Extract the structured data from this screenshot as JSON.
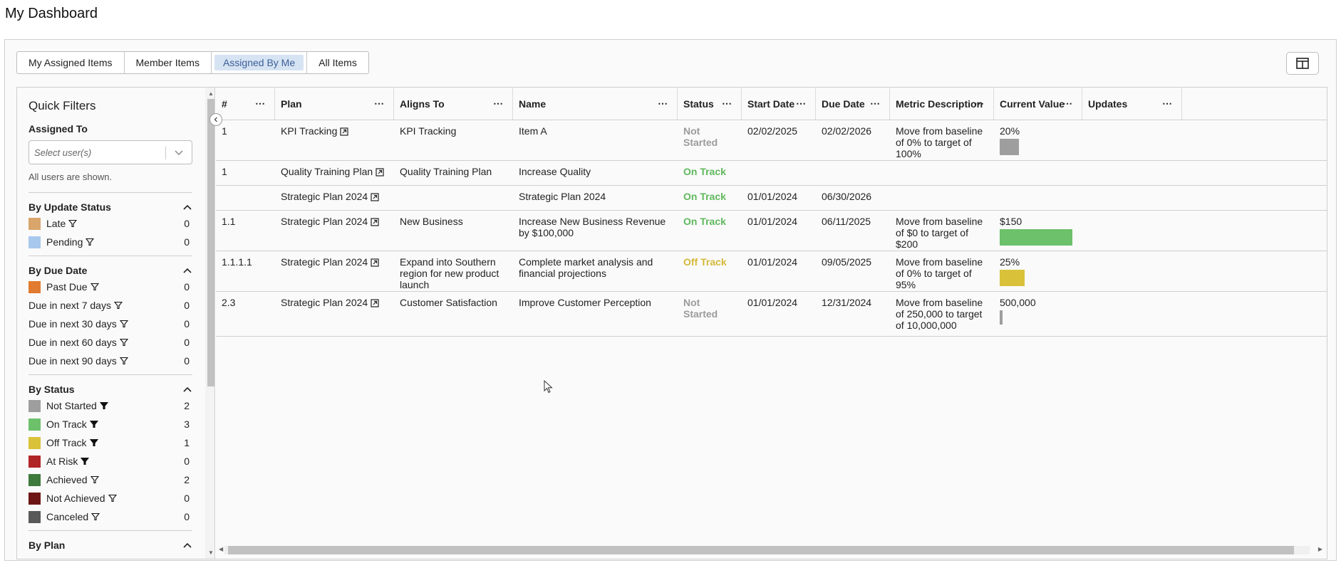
{
  "page_title": "My Dashboard",
  "tabs": [
    {
      "label": "My Assigned Items"
    },
    {
      "label": "Member Items"
    },
    {
      "label": "Assigned By Me"
    },
    {
      "label": "All Items"
    }
  ],
  "sidebar": {
    "title": "Quick Filters",
    "assigned_to_label": "Assigned To",
    "select_placeholder": "Select user(s)",
    "users_note": "All users are shown.",
    "update_status": {
      "heading": "By Update Status",
      "items": [
        {
          "label": "Late",
          "count": "0",
          "color": "#d9a56b"
        },
        {
          "label": "Pending",
          "count": "0",
          "color": "#a8c8ee"
        }
      ]
    },
    "due_date": {
      "heading": "By Due Date",
      "items": [
        {
          "label": "Past Due",
          "count": "0",
          "color": "#e07b30"
        },
        {
          "label": "Due in next 7 days",
          "count": "0"
        },
        {
          "label": "Due in next 30 days",
          "count": "0"
        },
        {
          "label": "Due in next 60 days",
          "count": "0"
        },
        {
          "label": "Due in next 90 days",
          "count": "0"
        }
      ]
    },
    "status": {
      "heading": "By Status",
      "items": [
        {
          "label": "Not Started",
          "count": "2",
          "color": "#9e9e9e",
          "filled": true
        },
        {
          "label": "On Track",
          "count": "3",
          "color": "#6cc16a",
          "filled": true
        },
        {
          "label": "Off Track",
          "count": "1",
          "color": "#d9c23a",
          "filled": true
        },
        {
          "label": "At Risk",
          "count": "0",
          "color": "#b02525",
          "filled": true
        },
        {
          "label": "Achieved",
          "count": "2",
          "color": "#3e7a3c",
          "filled": false
        },
        {
          "label": "Not Achieved",
          "count": "0",
          "color": "#6e1515",
          "filled": false
        },
        {
          "label": "Canceled",
          "count": "0",
          "color": "#595959",
          "filled": false
        }
      ]
    },
    "next_heading": "By Plan"
  },
  "grid": {
    "columns": [
      "#",
      "Plan",
      "Aligns To",
      "Name",
      "Status",
      "Start Date",
      "Due Date",
      "Metric Description",
      "Current Value",
      "Updates"
    ],
    "rows": [
      {
        "num": "1",
        "plan": "KPI Tracking",
        "aligns": "KPI Tracking",
        "name": "Item A",
        "status": "Not Started",
        "status_color": "#9b9b9b",
        "start": "02/02/2025",
        "due": "02/02/2026",
        "metric": "Move from baseline of 0% to target of 100%",
        "value": "20%",
        "progress": 0.2,
        "bar_color": "#9e9e9e"
      },
      {
        "num": "1",
        "plan": "Quality Training Plan",
        "aligns": "Quality Training Plan",
        "name": "Increase Quality",
        "status": "On Track",
        "status_color": "#5fb85c",
        "start": "",
        "due": "",
        "metric": "",
        "value": "",
        "progress": null,
        "bar_color": ""
      },
      {
        "num": "",
        "plan": "Strategic Plan 2024",
        "aligns": "",
        "name": "Strategic Plan 2024",
        "status": "On Track",
        "status_color": "#5fb85c",
        "start": "01/01/2024",
        "due": "06/30/2026",
        "metric": "",
        "value": "",
        "progress": null,
        "bar_color": ""
      },
      {
        "num": "1.1",
        "plan": "Strategic Plan 2024",
        "aligns": "New Business",
        "name": "Increase New Business Revenue by $100,000",
        "status": "On Track",
        "status_color": "#5fb85c",
        "start": "01/01/2024",
        "due": "06/11/2025",
        "metric": "Move from baseline of $0 to target of $200",
        "value": "$150",
        "progress": 0.75,
        "bar_color": "#6cc16a"
      },
      {
        "num": "1.1.1.1",
        "plan": "Strategic Plan 2024",
        "aligns": "Expand into Southern region for new product launch",
        "name": "Complete market analysis and financial projections",
        "status": "Off Track",
        "status_color": "#d4b93a",
        "start": "01/01/2024",
        "due": "09/05/2025",
        "metric": "Move from baseline of 0% to target of 95%",
        "value": "25%",
        "progress": 0.26,
        "bar_color": "#d9c23a"
      },
      {
        "num": "2.3",
        "plan": "Strategic Plan 2024",
        "aligns": "Customer Satisfaction",
        "name": "Improve Customer Perception",
        "status": "Not Started",
        "status_color": "#9b9b9b",
        "start": "01/01/2024",
        "due": "12/31/2024",
        "metric": "Move from baseline of 250,000 to target of 10,000,000",
        "value": "500,000",
        "progress": 0.03,
        "bar_color": "#9e9e9e"
      }
    ]
  }
}
